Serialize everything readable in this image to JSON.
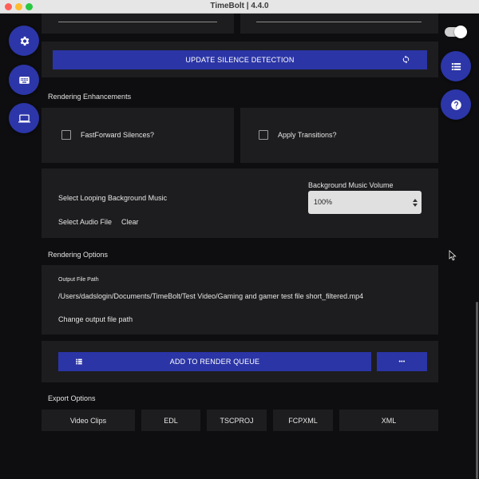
{
  "window": {
    "title": "TimeBolt | 4.4.0"
  },
  "sidebar_left": [
    {
      "icon": "gear-icon"
    },
    {
      "icon": "keyboard-icon"
    },
    {
      "icon": "laptop-icon"
    }
  ],
  "sidebar_right": [
    {
      "icon": "list-icon"
    },
    {
      "icon": "help-icon"
    }
  ],
  "silence": {
    "update_button": "UPDATE SILENCE DETECTION"
  },
  "rendering_enhancements": {
    "label": "Rendering Enhancements",
    "fast_forward": "FastForward Silences?",
    "apply_transitions": "Apply Transitions?"
  },
  "music": {
    "select_label": "Select Looping Background Music",
    "select_file": "Select Audio File",
    "clear": "Clear",
    "volume_label": "Background Music Volume",
    "volume_value": "100%"
  },
  "rendering_options": {
    "label": "Rendering Options",
    "output_label": "Output File Path",
    "output_path": "/Users/dadslogin/Documents/TimeBolt/Test Video/Gaming and gamer test file short_filtered.mp4",
    "change_path": "Change output file path",
    "add_queue": "ADD TO RENDER QUEUE",
    "more": "•••"
  },
  "export_options": {
    "label": "Export Options",
    "buttons": [
      "Video Clips",
      "EDL",
      "TSCPROJ",
      "FCPXML",
      "XML"
    ]
  },
  "colors": {
    "accent": "#2b35a6",
    "panel": "#1d1d1f",
    "background": "#0e0e10"
  }
}
